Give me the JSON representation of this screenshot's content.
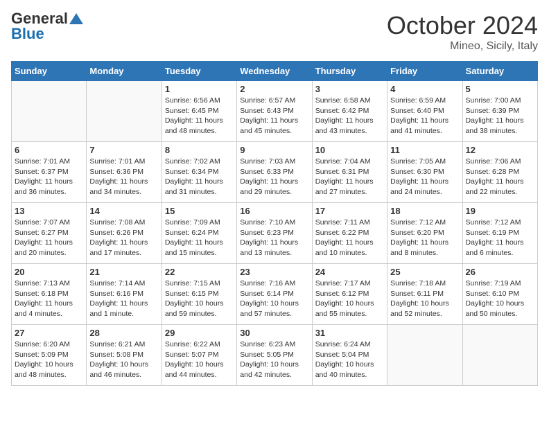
{
  "header": {
    "logo_general": "General",
    "logo_blue": "Blue",
    "month": "October 2024",
    "location": "Mineo, Sicily, Italy"
  },
  "days_of_week": [
    "Sunday",
    "Monday",
    "Tuesday",
    "Wednesday",
    "Thursday",
    "Friday",
    "Saturday"
  ],
  "weeks": [
    [
      {
        "day": "",
        "info": ""
      },
      {
        "day": "",
        "info": ""
      },
      {
        "day": "1",
        "info": "Sunrise: 6:56 AM\nSunset: 6:45 PM\nDaylight: 11 hours and 48 minutes."
      },
      {
        "day": "2",
        "info": "Sunrise: 6:57 AM\nSunset: 6:43 PM\nDaylight: 11 hours and 45 minutes."
      },
      {
        "day": "3",
        "info": "Sunrise: 6:58 AM\nSunset: 6:42 PM\nDaylight: 11 hours and 43 minutes."
      },
      {
        "day": "4",
        "info": "Sunrise: 6:59 AM\nSunset: 6:40 PM\nDaylight: 11 hours and 41 minutes."
      },
      {
        "day": "5",
        "info": "Sunrise: 7:00 AM\nSunset: 6:39 PM\nDaylight: 11 hours and 38 minutes."
      }
    ],
    [
      {
        "day": "6",
        "info": "Sunrise: 7:01 AM\nSunset: 6:37 PM\nDaylight: 11 hours and 36 minutes."
      },
      {
        "day": "7",
        "info": "Sunrise: 7:01 AM\nSunset: 6:36 PM\nDaylight: 11 hours and 34 minutes."
      },
      {
        "day": "8",
        "info": "Sunrise: 7:02 AM\nSunset: 6:34 PM\nDaylight: 11 hours and 31 minutes."
      },
      {
        "day": "9",
        "info": "Sunrise: 7:03 AM\nSunset: 6:33 PM\nDaylight: 11 hours and 29 minutes."
      },
      {
        "day": "10",
        "info": "Sunrise: 7:04 AM\nSunset: 6:31 PM\nDaylight: 11 hours and 27 minutes."
      },
      {
        "day": "11",
        "info": "Sunrise: 7:05 AM\nSunset: 6:30 PM\nDaylight: 11 hours and 24 minutes."
      },
      {
        "day": "12",
        "info": "Sunrise: 7:06 AM\nSunset: 6:28 PM\nDaylight: 11 hours and 22 minutes."
      }
    ],
    [
      {
        "day": "13",
        "info": "Sunrise: 7:07 AM\nSunset: 6:27 PM\nDaylight: 11 hours and 20 minutes."
      },
      {
        "day": "14",
        "info": "Sunrise: 7:08 AM\nSunset: 6:26 PM\nDaylight: 11 hours and 17 minutes."
      },
      {
        "day": "15",
        "info": "Sunrise: 7:09 AM\nSunset: 6:24 PM\nDaylight: 11 hours and 15 minutes."
      },
      {
        "day": "16",
        "info": "Sunrise: 7:10 AM\nSunset: 6:23 PM\nDaylight: 11 hours and 13 minutes."
      },
      {
        "day": "17",
        "info": "Sunrise: 7:11 AM\nSunset: 6:22 PM\nDaylight: 11 hours and 10 minutes."
      },
      {
        "day": "18",
        "info": "Sunrise: 7:12 AM\nSunset: 6:20 PM\nDaylight: 11 hours and 8 minutes."
      },
      {
        "day": "19",
        "info": "Sunrise: 7:12 AM\nSunset: 6:19 PM\nDaylight: 11 hours and 6 minutes."
      }
    ],
    [
      {
        "day": "20",
        "info": "Sunrise: 7:13 AM\nSunset: 6:18 PM\nDaylight: 11 hours and 4 minutes."
      },
      {
        "day": "21",
        "info": "Sunrise: 7:14 AM\nSunset: 6:16 PM\nDaylight: 11 hours and 1 minute."
      },
      {
        "day": "22",
        "info": "Sunrise: 7:15 AM\nSunset: 6:15 PM\nDaylight: 10 hours and 59 minutes."
      },
      {
        "day": "23",
        "info": "Sunrise: 7:16 AM\nSunset: 6:14 PM\nDaylight: 10 hours and 57 minutes."
      },
      {
        "day": "24",
        "info": "Sunrise: 7:17 AM\nSunset: 6:12 PM\nDaylight: 10 hours and 55 minutes."
      },
      {
        "day": "25",
        "info": "Sunrise: 7:18 AM\nSunset: 6:11 PM\nDaylight: 10 hours and 52 minutes."
      },
      {
        "day": "26",
        "info": "Sunrise: 7:19 AM\nSunset: 6:10 PM\nDaylight: 10 hours and 50 minutes."
      }
    ],
    [
      {
        "day": "27",
        "info": "Sunrise: 6:20 AM\nSunset: 5:09 PM\nDaylight: 10 hours and 48 minutes."
      },
      {
        "day": "28",
        "info": "Sunrise: 6:21 AM\nSunset: 5:08 PM\nDaylight: 10 hours and 46 minutes."
      },
      {
        "day": "29",
        "info": "Sunrise: 6:22 AM\nSunset: 5:07 PM\nDaylight: 10 hours and 44 minutes."
      },
      {
        "day": "30",
        "info": "Sunrise: 6:23 AM\nSunset: 5:05 PM\nDaylight: 10 hours and 42 minutes."
      },
      {
        "day": "31",
        "info": "Sunrise: 6:24 AM\nSunset: 5:04 PM\nDaylight: 10 hours and 40 minutes."
      },
      {
        "day": "",
        "info": ""
      },
      {
        "day": "",
        "info": ""
      }
    ]
  ]
}
